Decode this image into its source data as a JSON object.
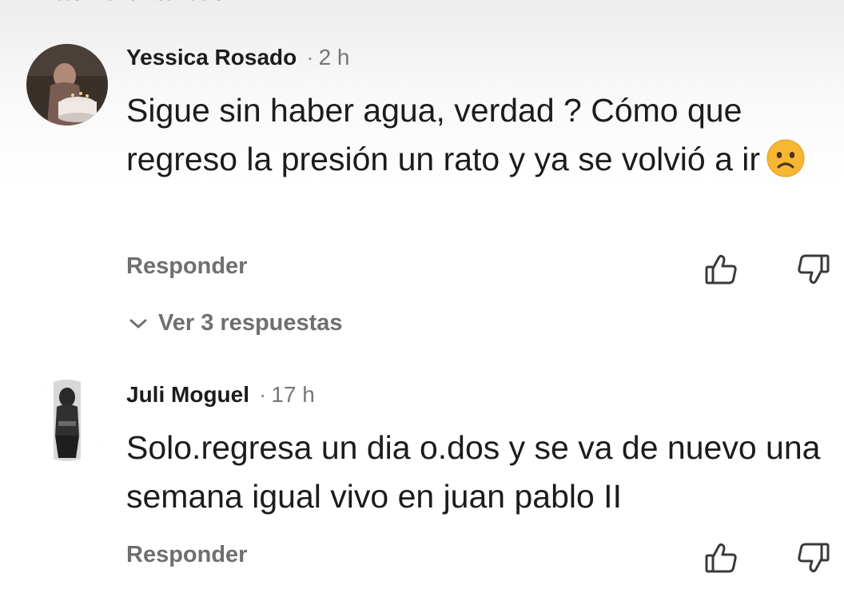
{
  "header": {
    "sort_label": "Más relevantes"
  },
  "comments": [
    {
      "author": "Yessica Rosado",
      "separator": "·",
      "time": "2 h",
      "text": "Sigue sin haber agua, verdad ? Cómo que regreso la presión un rato y ya se volvió a ir",
      "emoji": "frowning-face-emoji",
      "reply_label": "Responder",
      "like_icon": "thumbs-up-icon",
      "dislike_icon": "thumbs-down-icon",
      "view_replies_label": "Ver 3 respuestas"
    },
    {
      "author": "Juli Moguel",
      "separator": "·",
      "time": "17 h",
      "text": "Solo.regresa un dia o.dos y se va de nuevo una semana igual vivo en juan pablo II",
      "reply_label": "Responder",
      "like_icon": "thumbs-up-icon",
      "dislike_icon": "thumbs-down-icon"
    }
  ],
  "colors": {
    "text": "#1c1c1c",
    "muted": "#6f6f6f",
    "emoji": "#f7b733"
  }
}
